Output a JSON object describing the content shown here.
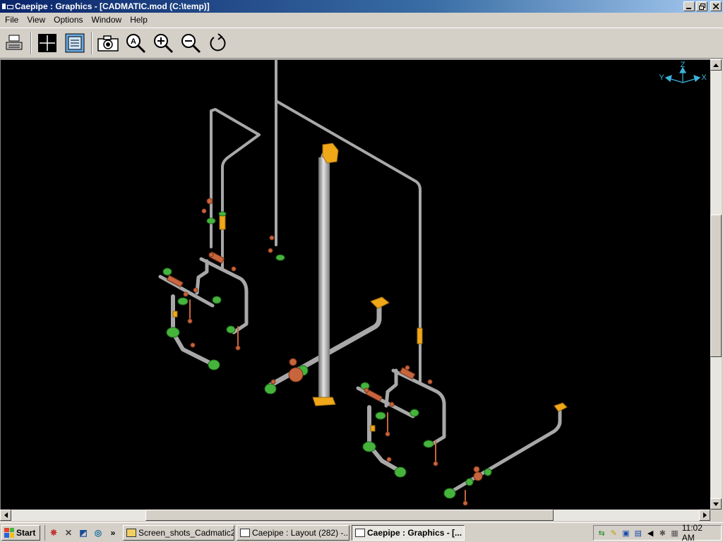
{
  "window": {
    "title": "Caepipe : Graphics - [CADMATIC.mod (C:\\temp)]",
    "min_label": "0",
    "max_label": "1",
    "close_label": "r"
  },
  "menu": [
    "File",
    "View",
    "Options",
    "Window",
    "Help"
  ],
  "toolbar": {
    "buttons": [
      "print-icon",
      "crosshair-icon",
      "document-list-icon",
      "camera-icon",
      "zoom-auto-icon",
      "zoom-in-icon",
      "zoom-out-icon",
      "rotate-icon"
    ]
  },
  "axes": {
    "z": "Z",
    "y": "Y",
    "x": "X"
  },
  "colors": {
    "viewport": "#000000",
    "pipe": "#b0b0b0",
    "valve": "#c8653c",
    "flange": "#46b43c",
    "support": "#f0a818",
    "axis": "#3cb4dc"
  },
  "taskbar": {
    "start": "Start",
    "tasks": [
      "Screen_shots_Cadmatic2KP",
      "Caepipe : Layout (282) -...",
      "Caepipe : Graphics - [..."
    ],
    "clock": "11:02 AM"
  }
}
